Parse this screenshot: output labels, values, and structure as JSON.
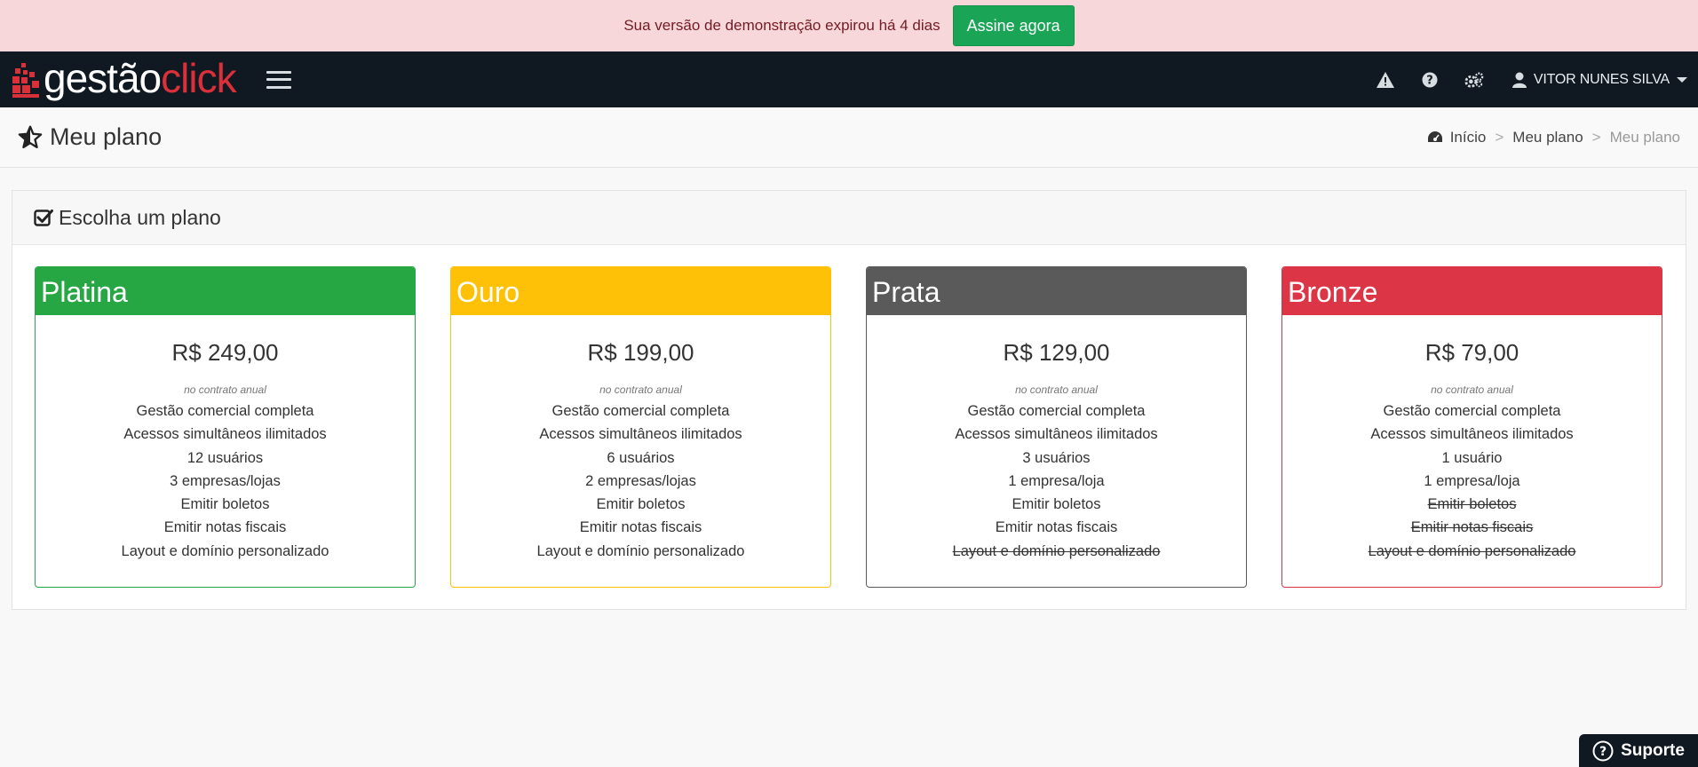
{
  "alert": {
    "message": "Sua versão de demonstração expirou há 4 dias",
    "cta": "Assine agora"
  },
  "navbar": {
    "logo_part1": "gestão",
    "logo_part2": "click",
    "icons": [
      "warning-icon",
      "help-icon",
      "settings-icon",
      "user-icon"
    ],
    "user_name": "VITOR NUNES SILVA"
  },
  "page": {
    "title": "Meu plano",
    "breadcrumb": [
      "Início",
      "Meu plano",
      "Meu plano"
    ]
  },
  "panel": {
    "title": "Escolha um plano"
  },
  "plans": [
    {
      "name": "Platina",
      "color": "#27a744",
      "price": "R$ 249,00",
      "note": "no contrato anual",
      "features": [
        {
          "text": "Gestão comercial completa",
          "included": true
        },
        {
          "text": "Acessos simultâneos ilimitados",
          "included": true
        },
        {
          "text": "12 usuários",
          "included": true
        },
        {
          "text": "3 empresas/lojas",
          "included": true
        },
        {
          "text": "Emitir boletos",
          "included": true
        },
        {
          "text": "Emitir notas fiscais",
          "included": true
        },
        {
          "text": "Layout e domínio personalizado",
          "included": true
        }
      ]
    },
    {
      "name": "Ouro",
      "color": "#fec107",
      "price": "R$ 199,00",
      "note": "no contrato anual",
      "features": [
        {
          "text": "Gestão comercial completa",
          "included": true
        },
        {
          "text": "Acessos simultâneos ilimitados",
          "included": true
        },
        {
          "text": "6 usuários",
          "included": true
        },
        {
          "text": "2 empresas/lojas",
          "included": true
        },
        {
          "text": "Emitir boletos",
          "included": true
        },
        {
          "text": "Emitir notas fiscais",
          "included": true
        },
        {
          "text": "Layout e domínio personalizado",
          "included": true
        }
      ]
    },
    {
      "name": "Prata",
      "color": "#5a5a5a",
      "price": "R$ 129,00",
      "note": "no contrato anual",
      "features": [
        {
          "text": "Gestão comercial completa",
          "included": true
        },
        {
          "text": "Acessos simultâneos ilimitados",
          "included": true
        },
        {
          "text": "3 usuários",
          "included": true
        },
        {
          "text": "1 empresa/loja",
          "included": true
        },
        {
          "text": "Emitir boletos",
          "included": true
        },
        {
          "text": "Emitir notas fiscais",
          "included": true
        },
        {
          "text": "Layout e domínio personalizado",
          "included": false
        }
      ]
    },
    {
      "name": "Bronze",
      "color": "#dc3545",
      "price": "R$ 79,00",
      "note": "no contrato anual",
      "features": [
        {
          "text": "Gestão comercial completa",
          "included": true
        },
        {
          "text": "Acessos simultâneos ilimitados",
          "included": true
        },
        {
          "text": "1 usuário",
          "included": true
        },
        {
          "text": "1 empresa/loja",
          "included": true
        },
        {
          "text": "Emitir boletos",
          "included": false
        },
        {
          "text": "Emitir notas fiscais",
          "included": false
        },
        {
          "text": "Layout e domínio personalizado",
          "included": false
        }
      ]
    }
  ],
  "support": {
    "label": "Suporte"
  }
}
